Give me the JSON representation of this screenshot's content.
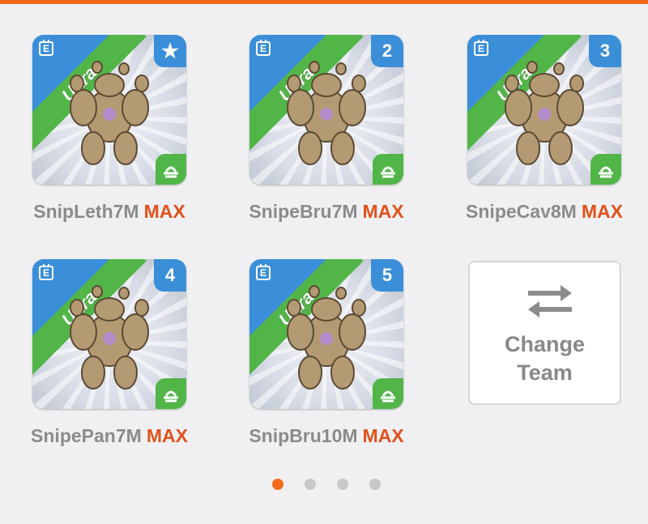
{
  "accent_color": "#f26a1b",
  "team": [
    {
      "name": "SnipLeth7M",
      "max_label": "MAX",
      "rarity": "Ultra",
      "slot_badge": "★",
      "badge_icon": "star-icon"
    },
    {
      "name": "SnipeBru7M",
      "max_label": "MAX",
      "rarity": "Ultra",
      "slot_badge": "2"
    },
    {
      "name": "SnipeCav8M",
      "max_label": "MAX",
      "rarity": "Ultra",
      "slot_badge": "3"
    },
    {
      "name": "SnipePan7M",
      "max_label": "MAX",
      "rarity": "Ultra",
      "slot_badge": "4"
    },
    {
      "name": "SnipBru10M",
      "max_label": "MAX",
      "rarity": "Ultra",
      "slot_badge": "5"
    }
  ],
  "element_icon": "earth-element-icon",
  "change_team": {
    "line1": "Change",
    "line2": "Team",
    "icon": "swap-arrows-icon"
  },
  "pagination": {
    "total": 4,
    "active": 1
  }
}
